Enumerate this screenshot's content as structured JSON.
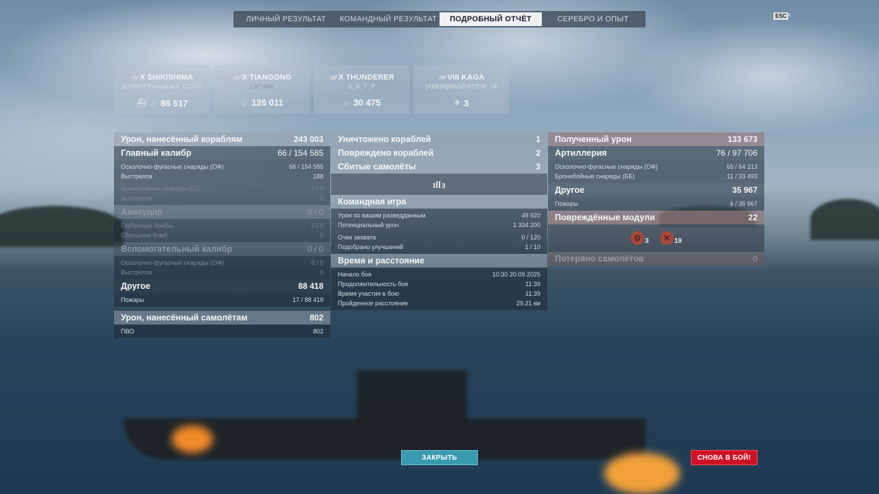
{
  "tabs": [
    {
      "label": "ЛИЧНЫЙ РЕЗУЛЬТАТ"
    },
    {
      "label": "КОМАНДНЫЙ РЕЗУЛЬТАТ"
    },
    {
      "label": "ПОДРОБНЫЙ ОТЧЁТ",
      "active": true
    },
    {
      "label": "СЕРЕБРО И ОПЫТ"
    }
  ],
  "esc_label": "ESC",
  "close_glyph": "×",
  "cards": [
    {
      "ship": "X SHIKISHIMA",
      "player": "[GHRST]Fomalhaut_CCCP",
      "value": "86 517",
      "icons": [
        "ship-damage-icon",
        "spotting-damage-icon"
      ]
    },
    {
      "ship": "X TIANGONG",
      "player": "LaFuMa",
      "value": "126 011",
      "icons": [
        "spotting-damage-icon"
      ]
    },
    {
      "ship": "X THUNDERER",
      "player": "S_A_T_P",
      "value": "30 475",
      "icons": [
        "spotting-damage-icon"
      ]
    },
    {
      "ship": "VIII KAGA",
      "player": "[AMUN]BAGRATION_74",
      "value": "3",
      "icons": [
        "planes-shot-icon"
      ]
    }
  ],
  "left": {
    "damage_ships": {
      "label": "Урон, нанесённый кораблям",
      "value": "243 003"
    },
    "main_battery": {
      "label": "Главный калибр",
      "value": "66 / 154 585"
    },
    "he_shells": {
      "label": "Осколочно-фугасные снаряды (ОФ)",
      "value": "66 / 154 585"
    },
    "shots": {
      "label": "Выстрелов",
      "value": "188"
    },
    "ap_shells": {
      "label": "Бронебойные снаряды (ББ)",
      "value": "0 / 0"
    },
    "ap_shots": {
      "label": "Выстрелов",
      "value": "0"
    },
    "airstrike": {
      "label": "Авиаудар",
      "value": "0 / 0"
    },
    "depth_charges": {
      "label": "Глубинные бомбы",
      "value": "0 / 0"
    },
    "bombs_dropped": {
      "label": "Сброшено бомб",
      "value": "0"
    },
    "secondary": {
      "label": "Вспомогательный калибр",
      "value": "0 / 0"
    },
    "sec_he": {
      "label": "Осколочно-фугасные снаряды (ОФ)",
      "value": "0 / 0"
    },
    "sec_shots": {
      "label": "Выстрелов",
      "value": "0"
    },
    "other": {
      "label": "Другое",
      "value": "88 418"
    },
    "fires": {
      "label": "Пожары",
      "value": "17 / 88 418"
    },
    "damage_planes": {
      "label": "Урон, нанесённый самолётам",
      "value": "802"
    },
    "aa": {
      "label": "ПВО",
      "value": "802"
    }
  },
  "middle": {
    "destroyed": {
      "label": "Уничтожено кораблей",
      "value": "1"
    },
    "damaged": {
      "label": "Повреждено кораблей",
      "value": "2"
    },
    "planes_shot": {
      "label": "Сбитые самолёты",
      "value": "3"
    },
    "planes_icon_count": "3",
    "team_game": {
      "label": "Командная игра"
    },
    "spotting_damage": {
      "label": "Урон по вашим разведданным",
      "value": "49 920"
    },
    "potential_damage": {
      "label": "Потенциальный урон",
      "value": "1 334 200"
    },
    "capture_points": {
      "label": "Очки захвата",
      "value": "0 / 120"
    },
    "upgrades": {
      "label": "Подобрано улучшений",
      "value": "1 / 10"
    },
    "time_distance": {
      "label": "Время и расстояние"
    },
    "battle_start": {
      "label": "Начало боя",
      "value": "10:30  20.09.2025"
    },
    "duration": {
      "label": "Продолжительность боя",
      "value": "11:39"
    },
    "participation": {
      "label": "Время участия в бою",
      "value": "11:39"
    },
    "distance": {
      "label": "Пройденное расстояние",
      "value": "29.21 км"
    }
  },
  "right": {
    "received": {
      "label": "Полученный урон",
      "value": "133 673"
    },
    "artillery": {
      "label": "Артиллерия",
      "value": "76 / 97 706"
    },
    "he_shells": {
      "label": "Осколочно-фугасные снаряды (ОФ)",
      "value": "65 / 64 213"
    },
    "ap_shells": {
      "label": "Бронебойные снаряды (ББ)",
      "value": "11 / 33 493"
    },
    "other": {
      "label": "Другое",
      "value": "35 967"
    },
    "fires": {
      "label": "Пожары",
      "value": "6 / 35 967"
    },
    "modules": {
      "label": "Повреждённые модули",
      "value": "22"
    },
    "module_a_count": "3",
    "module_b_count": "19",
    "planes_lost": {
      "label": "Потеряно самолётов",
      "value": "0"
    }
  },
  "buttons": {
    "close": "ЗАКРЫТЬ",
    "battle": "СНОВА В БОЙ!"
  }
}
